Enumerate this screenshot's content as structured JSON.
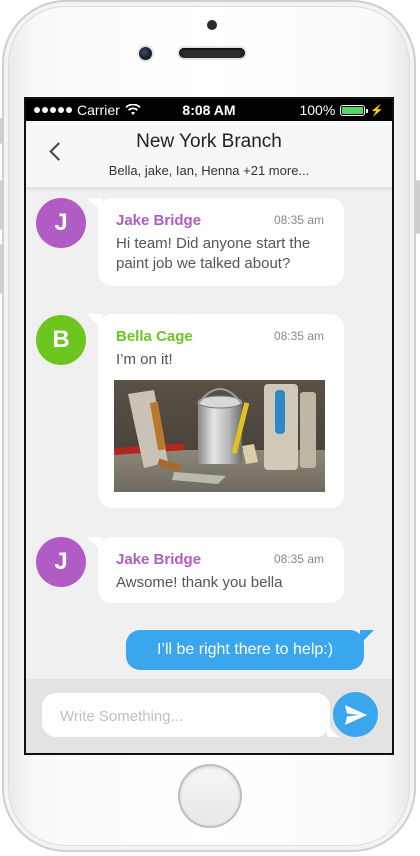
{
  "status_bar": {
    "carrier": "Carrier",
    "time": "8:08 AM",
    "battery": "100%",
    "battery_level": 1.0,
    "icons": [
      "signal-dots-icon",
      "wifi-icon",
      "battery-icon",
      "charging-bolt-icon"
    ]
  },
  "header": {
    "title": "New York Branch",
    "subtitle": "Bella, jake, Ian, Henna +21 more...",
    "back_icon": "chevron-left-icon"
  },
  "messages": [
    {
      "initial": "J",
      "sender": "Jake Bridge",
      "time": "08:35 am",
      "text": "Hi team! Did anyone start the paint job we talked about?",
      "avatar_color": "#b15bc4",
      "name_color": "#b15bc4"
    },
    {
      "initial": "B",
      "sender": "Bella Cage",
      "time": "08:35 am",
      "text": "I’m on it!",
      "avatar_color": "#6cc61f",
      "name_color": "#6cc61f",
      "attachment": "photo of paint bucket and plastering tools"
    },
    {
      "initial": "J",
      "sender": "Jake Bridge",
      "time": "08:35 am",
      "text": "Awsome! thank you bella",
      "avatar_color": "#b15bc4",
      "name_color": "#b15bc4"
    }
  ],
  "outgoing": {
    "text": "I’ll be right there to help:)",
    "color": "#3aa6ee"
  },
  "composer": {
    "placeholder": "Write Something...",
    "send_icon": "paper-plane-icon"
  }
}
